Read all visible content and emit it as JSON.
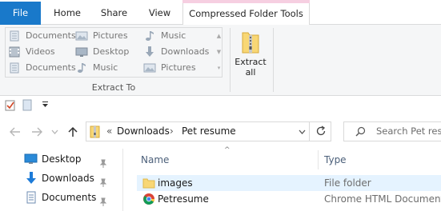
{
  "ribbon_tabs": {
    "file": "File",
    "home": "Home",
    "share": "Share",
    "view": "View",
    "compressed": "Compressed Folder Tools"
  },
  "extract_to": {
    "group_label": "Extract To",
    "items": [
      {
        "label": "Documents",
        "icon": "documents-icon"
      },
      {
        "label": "Pictures",
        "icon": "pictures-icon"
      },
      {
        "label": "Music",
        "icon": "music-icon"
      },
      {
        "label": "Videos",
        "icon": "videos-icon"
      },
      {
        "label": "Desktop",
        "icon": "desktop-icon"
      },
      {
        "label": "Downloads",
        "icon": "downloads-icon"
      },
      {
        "label": "Documents",
        "icon": "documents-icon"
      },
      {
        "label": "Music",
        "icon": "music-icon"
      },
      {
        "label": "Pictures",
        "icon": "pictures-icon"
      }
    ]
  },
  "extract_all": {
    "line1": "Extract",
    "line2": "all"
  },
  "breadcrumb": {
    "overflow": "«",
    "segments": [
      "Downloads",
      "Pet resume"
    ],
    "separator": "›"
  },
  "search": {
    "placeholder": "Search Pet resume"
  },
  "nav_pane": {
    "items": [
      {
        "label": "Desktop",
        "icon": "desktop-icon",
        "pinned": true
      },
      {
        "label": "Downloads",
        "icon": "downloads-icon",
        "pinned": true
      },
      {
        "label": "Documents",
        "icon": "documents-icon",
        "pinned": true
      }
    ]
  },
  "file_list": {
    "columns": {
      "name": "Name",
      "type": "Type"
    },
    "rows": [
      {
        "name": "images",
        "type": "File folder",
        "icon": "folder-icon",
        "selected": true
      },
      {
        "name": "Petresume",
        "type": "Chrome HTML Document",
        "icon": "chrome-icon",
        "selected": false
      }
    ]
  },
  "colors": {
    "file_tab": "#1979ca",
    "contextual_tab_accent": "#ed6ea9",
    "selection": "#e5f3ff",
    "folder": "#f8d775"
  }
}
